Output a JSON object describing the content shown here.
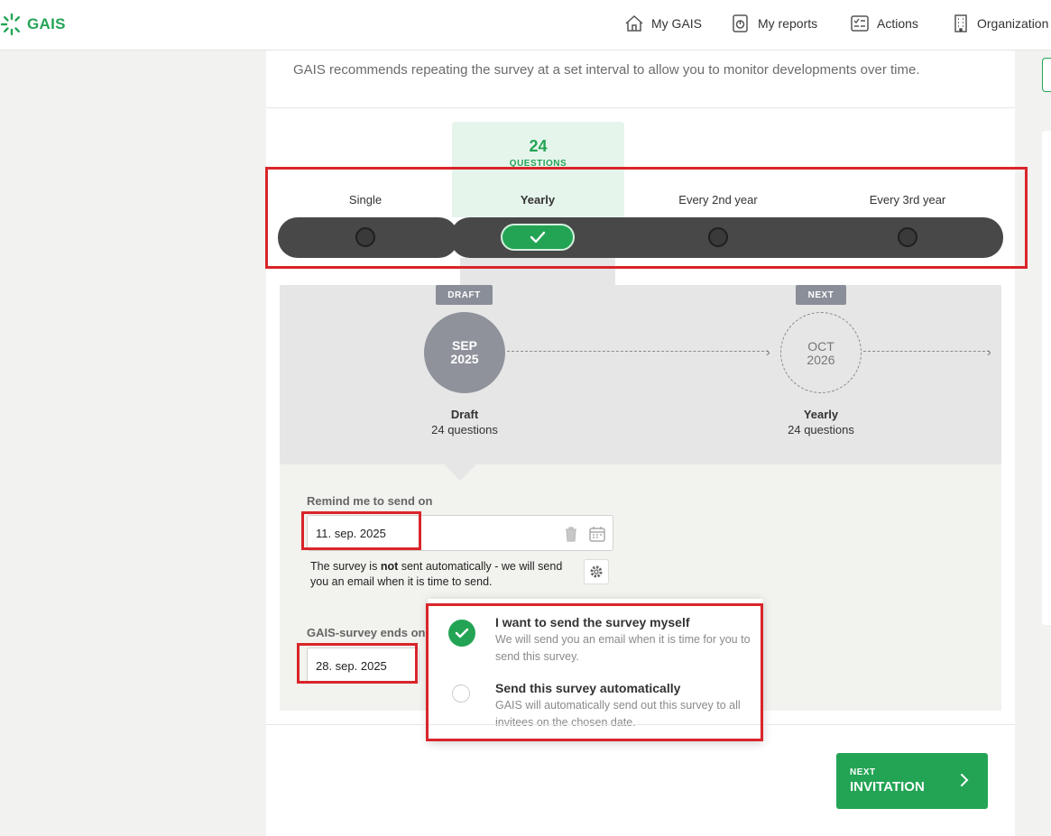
{
  "app": {
    "name": "GAIS"
  },
  "nav": {
    "my_gais": "My GAIS",
    "my_reports": "My reports",
    "actions": "Actions",
    "organization": "Organization"
  },
  "intro": "GAIS recommends repeating the survey at a set interval to allow you to monitor developments over time.",
  "frequency": {
    "question_count": "24",
    "question_label": "QUESTIONS",
    "options": [
      "Single",
      "Yearly",
      "Every 2nd year",
      "Every 3rd year"
    ],
    "selected": "Yearly"
  },
  "timeline": {
    "current": {
      "tag": "DRAFT",
      "month": "SEP",
      "year": "2025",
      "title": "Draft",
      "subtitle": "24 questions"
    },
    "next": {
      "tag": "NEXT",
      "month": "OCT",
      "year": "2026",
      "title": "Yearly",
      "subtitle": "24 questions"
    }
  },
  "remind": {
    "label": "Remind me to send on",
    "value": "11. sep. 2025",
    "help_prefix": "The survey is ",
    "help_bold": "not",
    "help_suffix": " sent automatically - we will send you an email when it is time to send."
  },
  "ends": {
    "label": "GAIS-survey ends on",
    "value": "28. sep. 2025"
  },
  "send_options": [
    {
      "title": "I want to send the survey myself",
      "desc": "We will send you an email when it is time for you to send this survey.",
      "selected": true
    },
    {
      "title": "Send this survey automatically",
      "desc": "GAIS will automatically send out this survey to all invitees on the chosen date.",
      "selected": false
    }
  ],
  "next_button": {
    "small": "NEXT",
    "label": "INVITATION"
  },
  "colors": {
    "accent": "#23a455",
    "dark_bar": "#484848",
    "highlight": "#d9252a"
  }
}
